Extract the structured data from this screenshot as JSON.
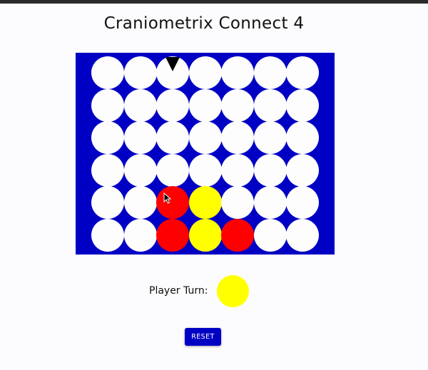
{
  "title": "Craniometrix Connect 4",
  "board": {
    "columns": 7,
    "rows": 6,
    "grid": [
      [
        "empty",
        "empty",
        "empty",
        "empty",
        "empty",
        "empty",
        "empty"
      ],
      [
        "empty",
        "empty",
        "empty",
        "empty",
        "empty",
        "empty",
        "empty"
      ],
      [
        "empty",
        "empty",
        "empty",
        "empty",
        "empty",
        "empty",
        "empty"
      ],
      [
        "empty",
        "empty",
        "empty",
        "empty",
        "empty",
        "empty",
        "empty"
      ],
      [
        "empty",
        "empty",
        "red",
        "yellow",
        "empty",
        "empty",
        "empty"
      ],
      [
        "empty",
        "empty",
        "red",
        "yellow",
        "red",
        "empty",
        "empty"
      ]
    ],
    "hover_column": 3
  },
  "turn": {
    "label": "Player Turn:",
    "player": "yellow"
  },
  "reset_label": "RESET",
  "colors": {
    "board": "#0000c4",
    "empty": "#fdfdfd",
    "red": "#ff0000",
    "yellow": "#ffff00",
    "button": "#0000c4"
  },
  "icons": {
    "drop_indicator": "down-triangle-icon",
    "cursor": "mouse-pointer-icon"
  }
}
